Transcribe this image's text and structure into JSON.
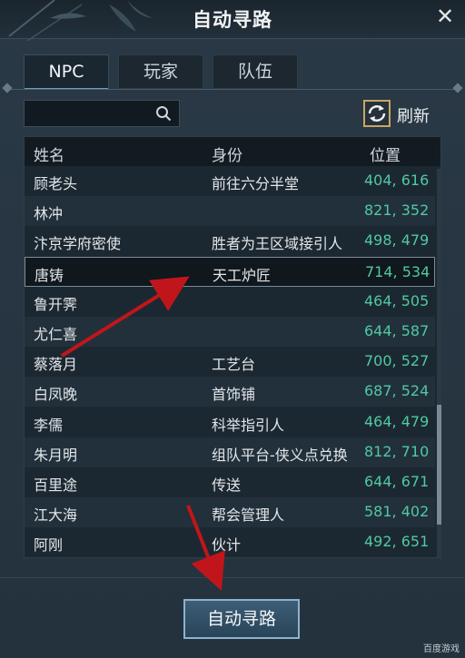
{
  "window": {
    "title": "自动寻路",
    "close_symbol": "✕"
  },
  "tabs": [
    {
      "label": "NPC",
      "active": true
    },
    {
      "label": "玩家",
      "active": false
    },
    {
      "label": "队伍",
      "active": false
    }
  ],
  "search": {
    "value": "",
    "placeholder": ""
  },
  "refresh": {
    "label": "刷新"
  },
  "table": {
    "headers": {
      "name": "姓名",
      "role": "身份",
      "pos": "位置"
    },
    "rows": [
      {
        "name": "顾老头",
        "role": "前往六分半堂",
        "pos": "404, 616"
      },
      {
        "name": "林冲",
        "role": "",
        "pos": "821, 352"
      },
      {
        "name": "汴京学府密使",
        "role": "胜者为王区域接引人",
        "pos": "498, 479"
      },
      {
        "name": "唐铸",
        "role": "天工炉匠",
        "pos": "714, 534",
        "selected": true
      },
      {
        "name": "鲁开霁",
        "role": "",
        "pos": "464, 505"
      },
      {
        "name": "尤仁喜",
        "role": "",
        "pos": "644, 587"
      },
      {
        "name": "蔡落月",
        "role": "工艺台",
        "pos": "700, 527"
      },
      {
        "name": "白凤晚",
        "role": "首饰铺",
        "pos": "687, 524"
      },
      {
        "name": "李儒",
        "role": "科举指引人",
        "pos": "464, 479"
      },
      {
        "name": "朱月明",
        "role": "组队平台-侠义点兑换",
        "pos": "812, 710"
      },
      {
        "name": "百里途",
        "role": "传送",
        "pos": "644, 671"
      },
      {
        "name": "江大海",
        "role": "帮会管理人",
        "pos": "581, 402"
      },
      {
        "name": "阿刚",
        "role": "伙计",
        "pos": "492, 651"
      }
    ]
  },
  "action_button": {
    "label": "自动寻路"
  },
  "watermark": {
    "text": "百度游戏"
  },
  "colors": {
    "accent": "#4fc9a3",
    "annotation_arrow": "#c0161b",
    "refresh_border": "#c9a664"
  }
}
